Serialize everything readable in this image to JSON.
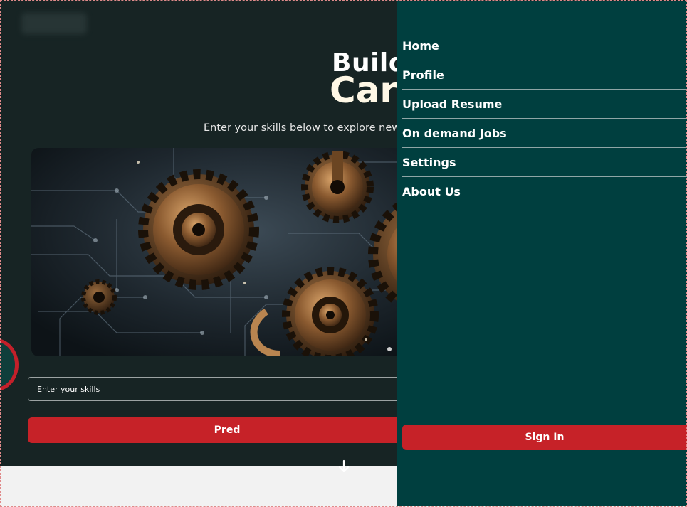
{
  "hero": {
    "title_line1": "Build",
    "title_line2": "Car",
    "subtitle": "Enter your skills below to explore new c",
    "skills_placeholder": "Enter your skills",
    "predict_label": "Pred",
    "scroll_icon": "arrow-down-icon"
  },
  "drawer": {
    "menu": [
      {
        "label": "Home"
      },
      {
        "label": "Profile"
      },
      {
        "label": "Upload Resume"
      },
      {
        "label": "On demand Jobs"
      },
      {
        "label": "Settings"
      },
      {
        "label": "About Us"
      }
    ],
    "signin_label": "Sign In"
  },
  "colors": {
    "hero_bg": "#172424",
    "drawer_bg": "#003f3f",
    "accent_red": "#c62228",
    "page_bg": "#f2f2f2"
  }
}
